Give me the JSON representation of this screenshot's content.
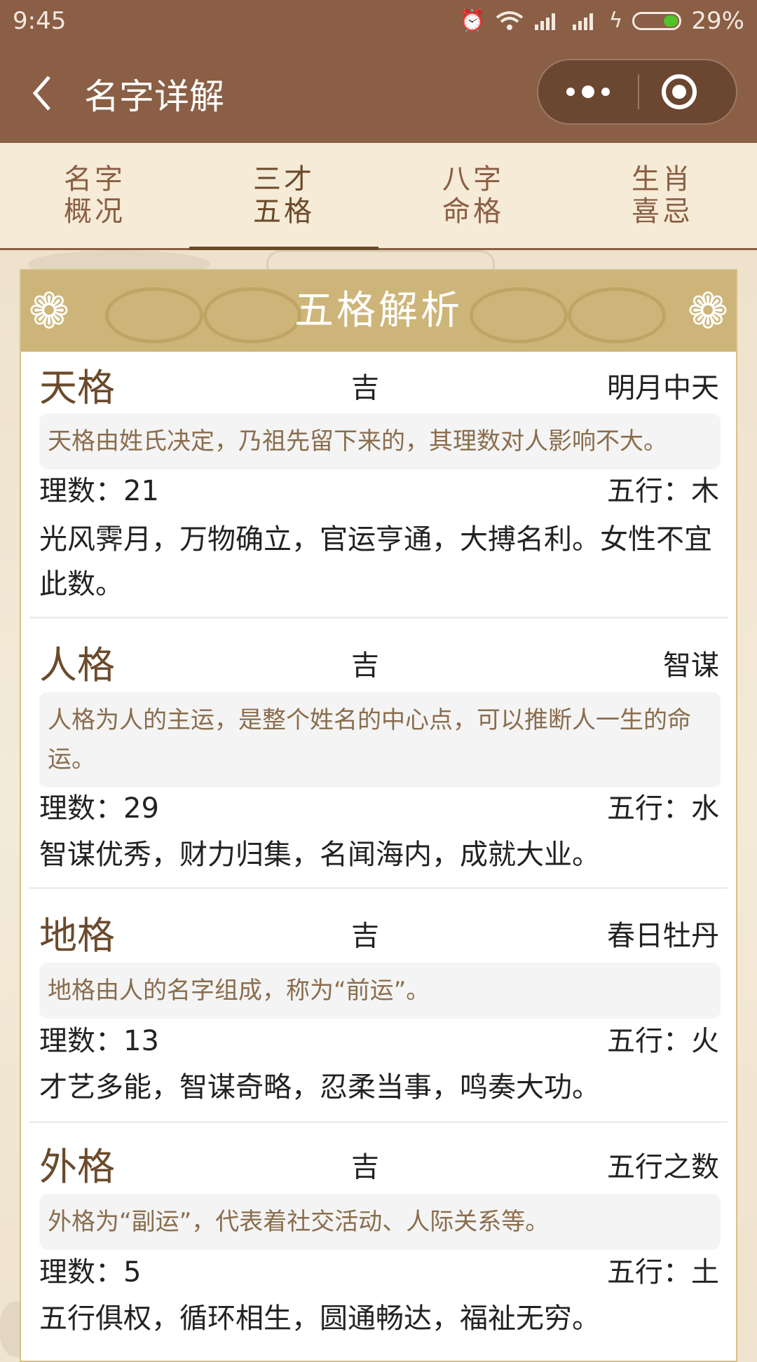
{
  "status_bar": {
    "time": "9:45",
    "battery": "29%"
  },
  "nav": {
    "title": "名字详解"
  },
  "tabs": [
    {
      "line1": "名字",
      "line2": "概况"
    },
    {
      "line1": "三才",
      "line2": "五格"
    },
    {
      "line1": "八字",
      "line2": "命格"
    },
    {
      "line1": "生肖",
      "line2": "喜忌"
    }
  ],
  "panel": {
    "title": "五格解析"
  },
  "items": [
    {
      "name": "天格",
      "luck": "吉",
      "tag": "明月中天",
      "desc": "天格由姓氏决定，乃祖先留下来的，其理数对人影响不大。",
      "number": "理数：21",
      "wuxing": "五行：木",
      "text": "光风霁月，万物确立，官运亨通，大搏名利。女性不宜此数。"
    },
    {
      "name": "人格",
      "luck": "吉",
      "tag": "智谋",
      "desc": "人格为人的主运，是整个姓名的中心点，可以推断人一生的命运。",
      "number": "理数：29",
      "wuxing": "五行：水",
      "text": "智谋优秀，财力归集，名闻海内，成就大业。"
    },
    {
      "name": "地格",
      "luck": "吉",
      "tag": "春日牡丹",
      "desc": "地格由人的名字组成，称为“前运”。",
      "number": "理数：13",
      "wuxing": "五行：火",
      "text": "才艺多能，智谋奇略，忍柔当事，鸣奏大功。"
    },
    {
      "name": "外格",
      "luck": "吉",
      "tag": "五行之数",
      "desc": "外格为“副运”，代表着社交活动、人际关系等。",
      "number": "理数：5",
      "wuxing": "五行：土",
      "text": "五行俱权，循环相生，圆通畅达，福祉无穷。"
    }
  ]
}
